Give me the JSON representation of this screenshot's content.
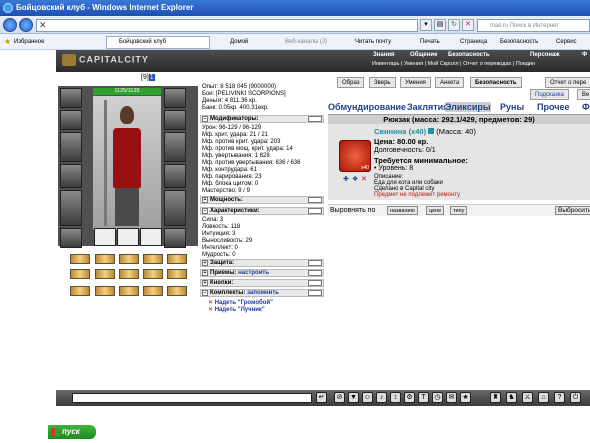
{
  "browser": {
    "title": "Бойцовский клуб - Windows Internet Explorer",
    "search_placeholder": "mail.ru Поиск в Интернет",
    "favorites_label": "Избранное",
    "tab_label": "Бойцовский клуб",
    "toolbar": {
      "home": "Домой",
      "feeds": "Веб-каналы (J)",
      "read_mail": "Читать почту",
      "print": "Печать",
      "page": "Страница",
      "safety": "Безопасность",
      "service": "Сервис"
    }
  },
  "game": {
    "logo": "CAPITALCITY",
    "top_menu": [
      "Знания",
      "Общение",
      "Безопасность",
      "Персонаж",
      "Ф"
    ],
    "sub_menu": "Инвентарь | Умения | Мой Скролл | Отчет о переводах | Поедин",
    "level_prefix": "[9]",
    "level_badge": "1",
    "hp": "1125/1125",
    "stats": {
      "experience": "Опыт: 8 518 045 (9000000)",
      "battles": "Бои: [PELIVINKI SCORPIONS]",
      "money": "Деньги: 4 811.36 кр.",
      "bank": "Банк: 0.05кр. 400.31екр."
    },
    "modifiers": {
      "title": "Модификаторы:",
      "lines": [
        "Урон: 96-129 / 96-129",
        "Мф. крит. удара: 21 / 21",
        "Мф. против крит. удара: 203",
        "Мф. против мощ. крит. удара: 14",
        "Мф. увертывания: 1 828",
        "Мф. против увертывания: 636 / 636",
        "Мф. контрудара: 61",
        "Мф. парирования: 23",
        "Мф. блока щитом: 0",
        "Мастерство: 9 / 9"
      ]
    },
    "power_title": "Мощность:",
    "characteristics": {
      "title": "Характеристики:",
      "lines": [
        "Сила: 3",
        "Ловкость: 118",
        "Интуиция: 3",
        "Выносливость: 29",
        "Интеллект: 0",
        "Мудрость: 0"
      ]
    },
    "protection_title": "Защита:",
    "techniques_title": "Приемы:",
    "techniques_link": "настроить",
    "buttons_title": "Кнопки:",
    "sets_title": "Комплекты:",
    "sets_link": "запомнить",
    "sets": [
      "Надеть \"Громобой\"",
      "Надеть \"Лучник\""
    ],
    "right_buttons": [
      "Образ",
      "Зверь",
      "Умения",
      "Анкета",
      "Безопасность",
      "Отчет о пере"
    ],
    "subtab_buttons": [
      "Подсказка",
      "Ве"
    ],
    "categories": [
      "Обмундирование",
      "Заклятия",
      "Эликсиры",
      "Руны",
      "Прочее",
      "Ф"
    ],
    "backpack": "Рюкзак (масса: 292.1/429, предметов: 29)",
    "item": {
      "name": "Свинина (x40)",
      "mass": "(Масса: 40)",
      "price": "Цена: 80.00 кр.",
      "durability": "Долговечность: 0/1",
      "requirement": "Требуется минимальное:",
      "level_req": "• Уровень: 8",
      "description_label": "Описание:",
      "description": "Еда для кота или собаки",
      "made_in": "Сделано в Capital city",
      "not_repairable": "Предмет не подлежит ремонту",
      "count_badge": "x40"
    },
    "sort": {
      "label": "Выровнять по",
      "buttons": [
        "названию",
        "цене",
        "типу"
      ],
      "throw": "Выбросить"
    }
  },
  "taskbar": {
    "start": "пуск"
  }
}
